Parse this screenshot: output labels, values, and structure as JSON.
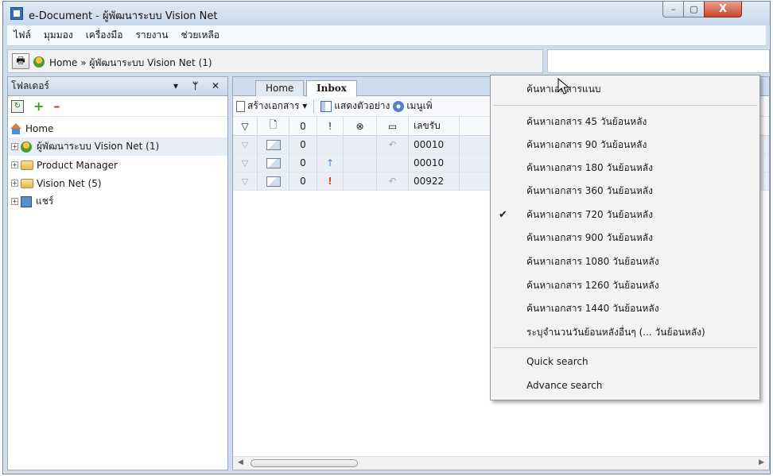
{
  "window": {
    "title": "e-Document - ผู้พัฒนาระบบ Vision Net",
    "controls": {
      "close": "X",
      "max": "▢",
      "min": "–"
    }
  },
  "menubar": [
    "ไฟล์",
    "มุมมอง",
    "เครื่องมือ",
    "รายงาน",
    "ช่วยเหลือ"
  ],
  "address": {
    "path": "Home » ผู้พัฒนาระบบ Vision Net (1)"
  },
  "folders_panel": {
    "title": "โฟลเดอร์",
    "controls": [
      "▾",
      "ᛘ",
      "✕"
    ],
    "tree": [
      {
        "label": "Home"
      },
      {
        "label": "ผู้พัฒนาระบบ Vision Net (1)",
        "selected": true
      },
      {
        "label": "Product Manager"
      },
      {
        "label": "Vision Net (5)"
      },
      {
        "label": "แชร์"
      }
    ]
  },
  "content": {
    "tabs": [
      "Home",
      "Inbox"
    ],
    "toolbar": {
      "create_doc": "สร้างเอกสาร ▾",
      "show_preview": "แสดงตัวอย่าง",
      "more_menu": "เมนูเพิ่"
    },
    "columns": [
      "▽",
      "🗋",
      "0",
      "!",
      "⊗",
      "▭",
      "เลขรับ"
    ],
    "rows": [
      {
        "flag": "▽",
        "clip": "0",
        "priority": "",
        "reply": "↶",
        "number": "00010"
      },
      {
        "flag": "▽",
        "clip": "0",
        "priority": "↑",
        "reply": "",
        "number": "00010"
      },
      {
        "flag": "▽",
        "clip": "0",
        "priority": "!",
        "reply": "↶",
        "number": "00922"
      }
    ]
  },
  "dropdown": {
    "items": [
      {
        "label": "ค้นหาเอกสารแนบ"
      },
      {
        "label": "ค้นหาเอกสาร 45 วันย้อนหลัง"
      },
      {
        "label": "ค้นหาเอกสาร 90 วันย้อนหลัง"
      },
      {
        "label": "ค้นหาเอกสาร 180 วันย้อนหลัง"
      },
      {
        "label": "ค้นหาเอกสาร 360 วันย้อนหลัง"
      },
      {
        "label": "ค้นหาเอกสาร 720 วันย้อนหลัง",
        "checked": true
      },
      {
        "label": "ค้นหาเอกสาร 900 วันย้อนหลัง"
      },
      {
        "label": "ค้นหาเอกสาร 1080 วันย้อนหลัง"
      },
      {
        "label": "ค้นหาเอกสาร 1260 วันย้อนหลัง"
      },
      {
        "label": "ค้นหาเอกสาร 1440 วันย้อนหลัง"
      },
      {
        "label": "ระบุจำนวนวันย้อนหลังอื่นๆ (... วันย้อนหลัง)"
      },
      {
        "label": "Quick search"
      },
      {
        "label": "Advance search"
      }
    ],
    "check_mark": "✔"
  }
}
